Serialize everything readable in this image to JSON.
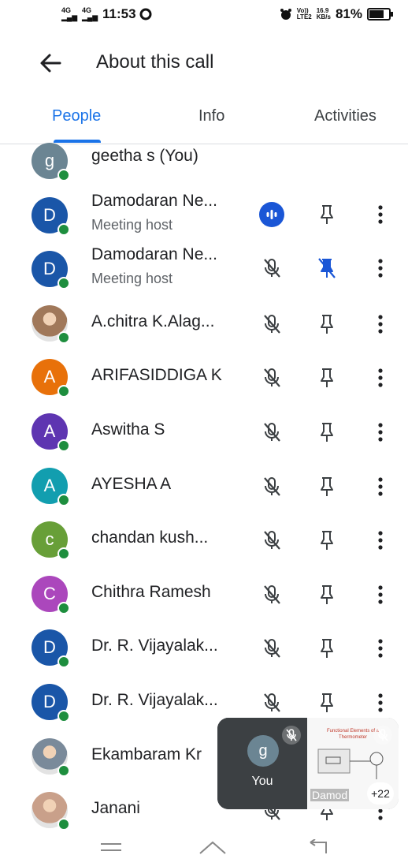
{
  "status_bar": {
    "network_1": "4G",
    "network_2": "4G",
    "time": "11:53",
    "volte": "Vo))",
    "lte": "LTE2",
    "speed_value": "16.9",
    "speed_unit": "KB/s",
    "battery_percent_text": "81%",
    "battery_level": 0.81
  },
  "header": {
    "title": "About this call"
  },
  "tabs": [
    {
      "label": "People",
      "active": true
    },
    {
      "label": "Info",
      "active": false
    },
    {
      "label": "Activities",
      "active": false
    }
  ],
  "participants": [
    {
      "name": "geetha s (You)",
      "role": "",
      "initial": "g",
      "avatar_color": "#6b8593",
      "avatar_type": "letter",
      "mic": "none",
      "pin": "none"
    },
    {
      "name": "Damodaran Ne...",
      "role": "Meeting host",
      "initial": "D",
      "avatar_color": "#1a56a8",
      "avatar_type": "letter",
      "mic": "speaking",
      "pin": "normal"
    },
    {
      "name": "Damodaran Ne...",
      "role": "Meeting host",
      "initial": "D",
      "avatar_color": "#1a56a8",
      "avatar_type": "letter",
      "mic": "muted",
      "pin": "pinned"
    },
    {
      "name": "A.chitra K.Alag...",
      "role": "",
      "initial": "",
      "avatar_color": "#a0785a",
      "avatar_type": "photo",
      "mic": "muted",
      "pin": "normal"
    },
    {
      "name": "ARIFASIDDIGA K",
      "role": "",
      "initial": "A",
      "avatar_color": "#e8710a",
      "avatar_type": "letter",
      "mic": "muted",
      "pin": "normal"
    },
    {
      "name": "Aswitha S",
      "role": "",
      "initial": "A",
      "avatar_color": "#5e35b1",
      "avatar_type": "letter",
      "mic": "muted",
      "pin": "normal"
    },
    {
      "name": "AYESHA A",
      "role": "",
      "initial": "A",
      "avatar_color": "#129eaf",
      "avatar_type": "letter",
      "mic": "muted",
      "pin": "normal"
    },
    {
      "name": "chandan kush...",
      "role": "",
      "initial": "c",
      "avatar_color": "#689f38",
      "avatar_type": "letter",
      "mic": "muted",
      "pin": "normal"
    },
    {
      "name": "Chithra Ramesh",
      "role": "",
      "initial": "C",
      "avatar_color": "#ab47bc",
      "avatar_type": "letter",
      "mic": "muted",
      "pin": "normal"
    },
    {
      "name": "Dr. R. Vijayalak...",
      "role": "",
      "initial": "D",
      "avatar_color": "#1a56a8",
      "avatar_type": "letter",
      "mic": "muted",
      "pin": "normal"
    },
    {
      "name": "Dr. R. Vijayalak...",
      "role": "",
      "initial": "D",
      "avatar_color": "#1a56a8",
      "avatar_type": "letter",
      "mic": "muted",
      "pin": "normal"
    },
    {
      "name": "Ekambaram Kr",
      "role": "",
      "initial": "",
      "avatar_color": "#7a8a9a",
      "avatar_type": "photo",
      "mic": "muted",
      "pin": "normal"
    },
    {
      "name": "Janani",
      "role": "",
      "initial": "",
      "avatar_color": "#c9a08a",
      "avatar_type": "photo",
      "mic": "muted",
      "pin": "normal"
    }
  ],
  "pip": {
    "self_initial": "g",
    "self_label": "You",
    "share_label": "Damod",
    "more_count": "+22"
  }
}
